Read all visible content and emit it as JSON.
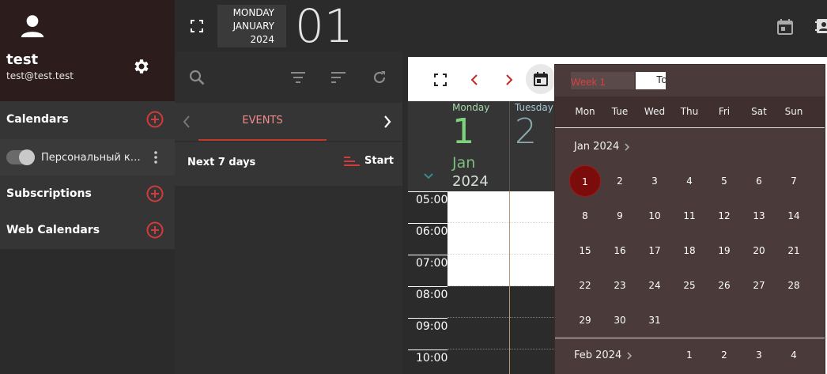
{
  "user": {
    "name": "test",
    "email": "test@test.test"
  },
  "sidebar": {
    "calendars_label": "Calendars",
    "calendar_item": "Персональный календарь",
    "subscriptions_label": "Subscriptions",
    "web_calendars_label": "Web Calendars"
  },
  "topbar": {
    "weekday": "MONDAY",
    "month": "JANUARY",
    "year": "2024",
    "day": "01"
  },
  "middle": {
    "tab_label": "EVENTS",
    "range_label": "Next 7 days",
    "sort_label": "Start"
  },
  "calendar": {
    "days": [
      {
        "name": "Monday",
        "number": "1",
        "month": "Jan",
        "year": "2024"
      },
      {
        "name": "Tuesday",
        "number": "2"
      }
    ],
    "times": [
      "05:00",
      "06:00",
      "07:00",
      "08:00",
      "09:00",
      "10:00"
    ]
  },
  "picker": {
    "week_value": "Week 1",
    "today_label": "Today",
    "weekdays": [
      "Mon",
      "Tue",
      "Wed",
      "Thu",
      "Fri",
      "Sat",
      "Sun"
    ],
    "month1_label": "Jan 2024",
    "month1_days": [
      "1",
      "2",
      "3",
      "4",
      "5",
      "6",
      "7",
      "8",
      "9",
      "10",
      "11",
      "12",
      "13",
      "14",
      "15",
      "16",
      "17",
      "18",
      "19",
      "20",
      "21",
      "22",
      "23",
      "24",
      "25",
      "26",
      "27",
      "28",
      "29",
      "30",
      "31"
    ],
    "month2_label": "Feb 2024",
    "month2_days": [
      "1",
      "2",
      "3",
      "4"
    ],
    "selected": "1"
  },
  "colors": {
    "accent": "#c0392b",
    "selected_day": "#7a0c0c",
    "day_green": "#7cd37c"
  }
}
